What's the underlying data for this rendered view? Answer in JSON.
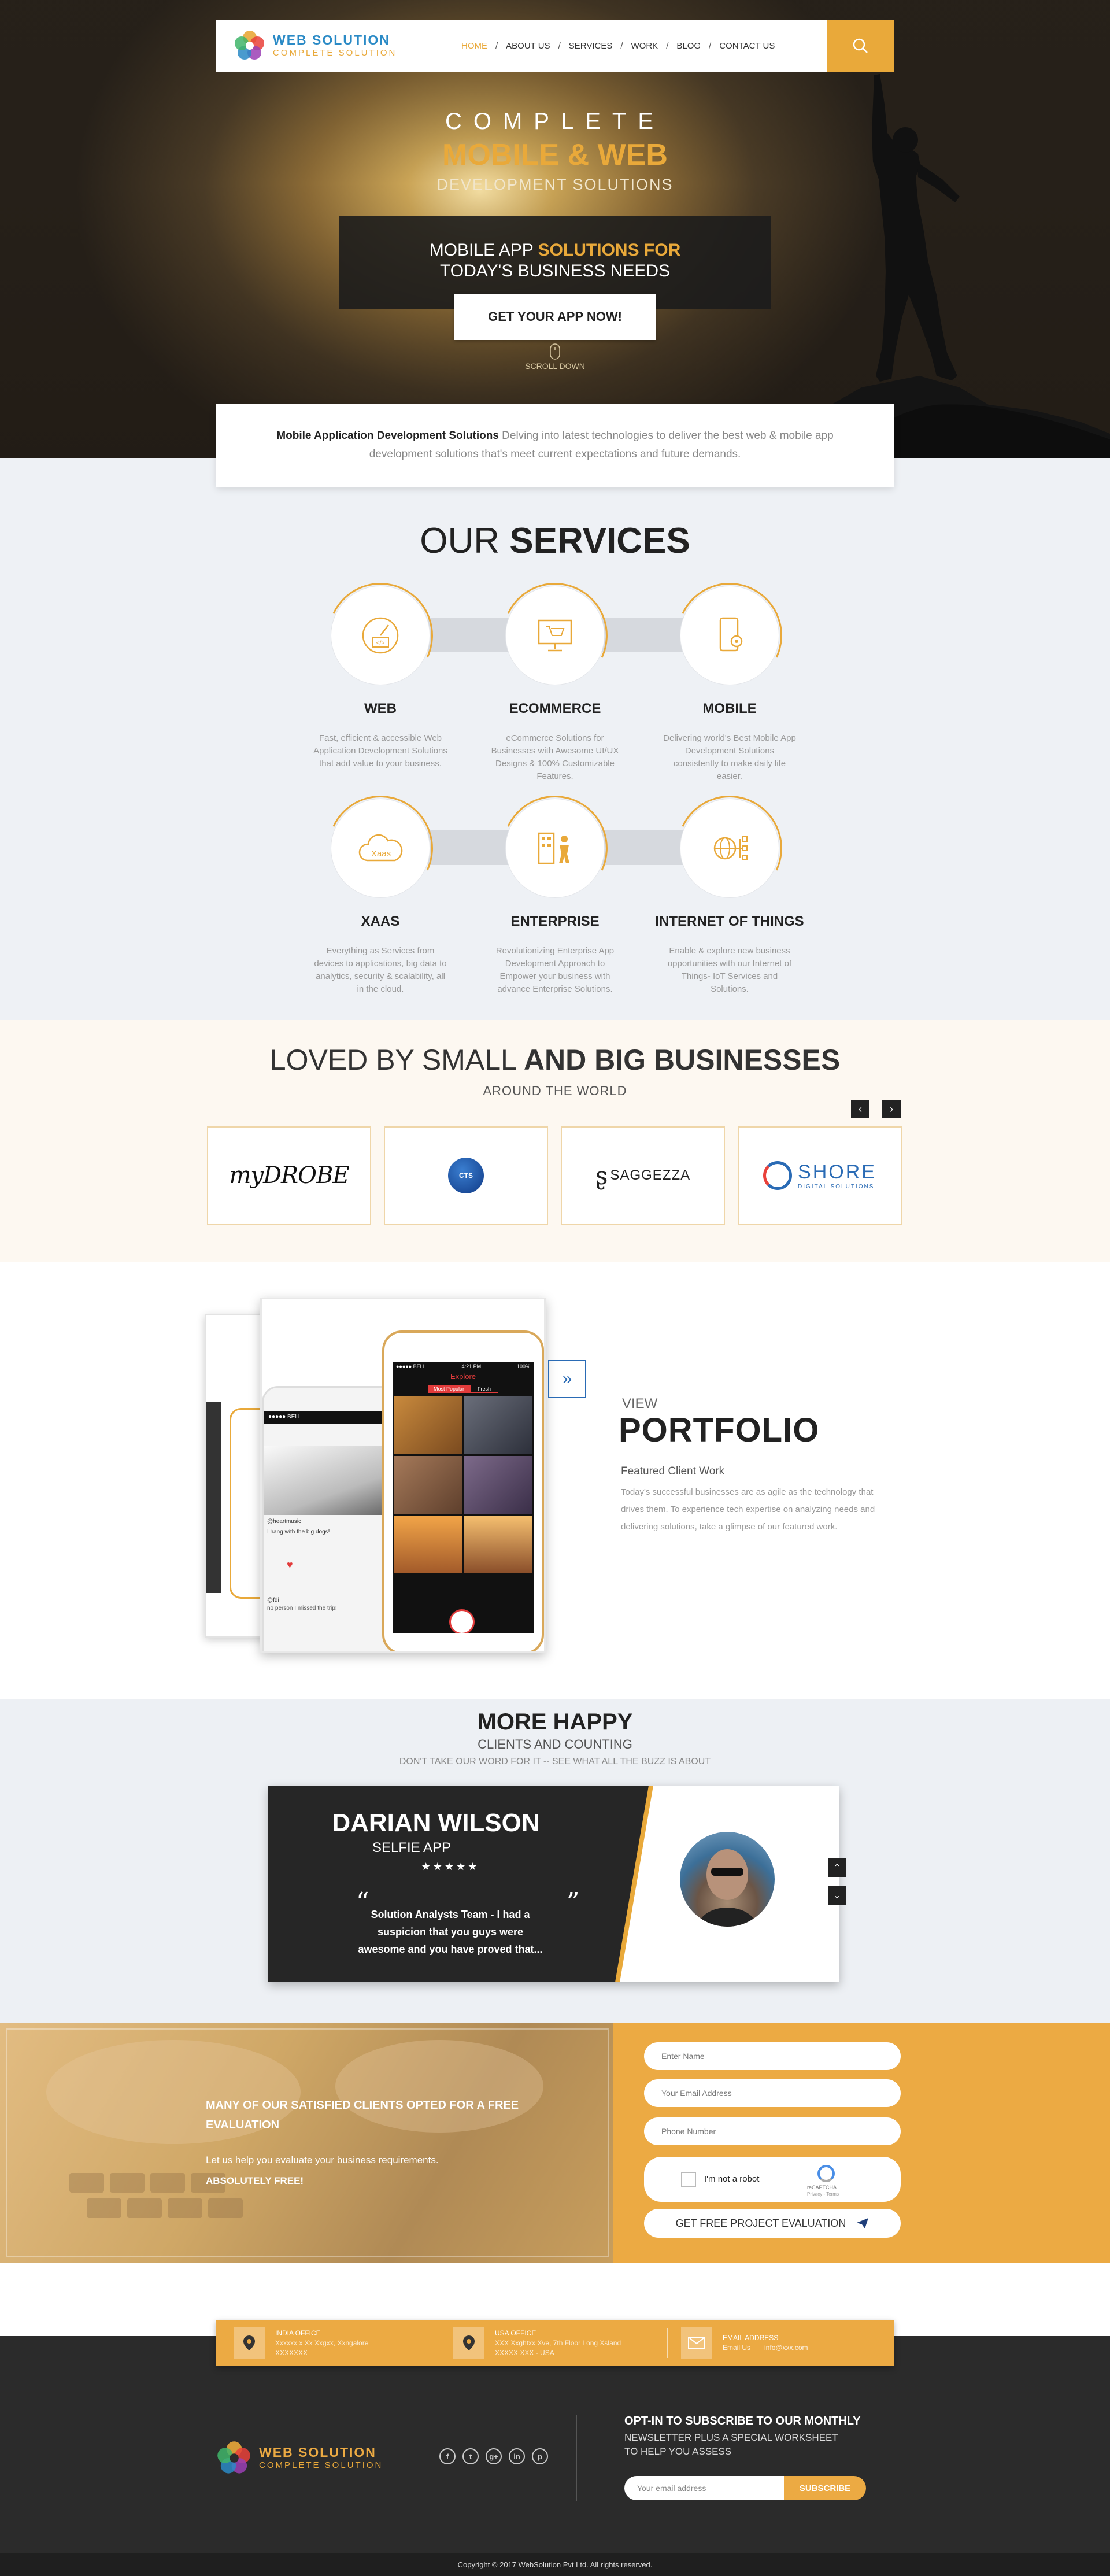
{
  "brand": {
    "name": "WEB SOLUTION",
    "tagline": "COMPLETE SOLUTION"
  },
  "nav": {
    "items": [
      {
        "label": "HOME",
        "active": true
      },
      {
        "label": "ABOUT US",
        "active": false
      },
      {
        "label": "SERVICES",
        "active": false
      },
      {
        "label": "WORK",
        "active": false
      },
      {
        "label": "BLOG",
        "active": false
      },
      {
        "label": "CONTACT US",
        "active": false
      }
    ],
    "search_icon": "search-icon"
  },
  "hero": {
    "line1": "COMPLETE",
    "line2": "MOBILE & WEB",
    "line3": "DEVELOPMENT SOLUTIONS",
    "box_line1_plain": "MOBILE APP ",
    "box_line1_accent": "SOLUTIONS FOR",
    "box_line2": "TODAY'S BUSINESS NEEDS",
    "cta": "GET YOUR APP NOW!",
    "scroll": "SCROLL DOWN"
  },
  "intro": {
    "bold": "Mobile Application Development Solutions",
    "text": " Delving into latest technologies to deliver the best web & mobile app development solutions that's meet current expectations and future demands."
  },
  "services": {
    "title_plain": "OUR ",
    "title_bold": "SERVICES",
    "items": [
      {
        "title": "WEB",
        "desc": "Fast, efficient & accessible Web Application Development Solutions that add value to your business.",
        "icon": "speedometer-code-icon"
      },
      {
        "title": "ECOMMERCE",
        "desc": "eCommerce Solutions for Businesses with Awesome UI/UX Designs & 100% Customizable Features.",
        "icon": "shopping-cart-monitor-icon"
      },
      {
        "title": "MOBILE",
        "desc": "Delivering world's Best Mobile App Development Solutions consistently to make daily life easier.",
        "icon": "mobile-gear-icon"
      },
      {
        "title": "XAAS",
        "desc": "Everything as Services from devices to applications, big data to analytics, security & scalability, all in the cloud.",
        "icon": "cloud-xaas-icon",
        "icon_text": "Xaas"
      },
      {
        "title": "ENTERPRISE",
        "desc": "Revolutionizing Enterprise App Development Approach to Empower your business with advance Enterprise Solutions.",
        "icon": "building-person-icon"
      },
      {
        "title": "INTERNET OF THINGS",
        "desc": "Enable & explore new business opportunities with our Internet of Things- IoT Services and Solutions.",
        "icon": "globe-network-icon"
      }
    ]
  },
  "clients": {
    "title_plain": "LOVED BY SMALL ",
    "title_bold": "AND BIG BUSINESSES",
    "subtitle": "AROUND THE WORLD",
    "prev": "‹",
    "next": "›",
    "logos": [
      {
        "name": "myDROBE"
      },
      {
        "name": "CTS"
      },
      {
        "name": "SAGGEZZA"
      },
      {
        "name": "SHORE",
        "sub": "DIGITAL SOLUTIONS"
      }
    ]
  },
  "portfolio": {
    "view": "VIEW",
    "title": "PORTFOLIO",
    "subtitle": "Featured Client Work",
    "desc": "Today's successful businesses are as agile as the technology that drives them. To experience tech expertise on analyzing needs and delivering solutions, take a glimpse of our featured work.",
    "next_icon": "double-chevron-right-icon",
    "phone": {
      "carrier": "●●●●● BELL",
      "time": "4:21 PM",
      "battery": "100%",
      "app_title": "Explore",
      "tabs": [
        "Most Popular",
        "Fresh"
      ],
      "back_caption": "I hang with the big dogs!",
      "back_user": "@heartmusic",
      "comment_user": "@fdi",
      "comment": "no person I missed the trip!"
    }
  },
  "testimonial": {
    "title": "MORE HAPPY",
    "subtitle": "CLIENTS AND COUNTING",
    "tagline": "DON'T TAKE OUR WORD FOR IT -- SEE WHAT ALL THE BUZZ IS ABOUT",
    "name": "DARIAN WILSON",
    "app": "SELFIE APP",
    "stars": "★★★★★",
    "quote": "Solution Analysts Team - I had a suspicion that you guys were awesome and you have proved that...",
    "up": "⌃",
    "down": "⌄"
  },
  "evaluation": {
    "title": "MANY OF OUR SATISFIED CLIENTS OPTED FOR A FREE EVALUATION",
    "desc": "Let us help you evaluate your business requirements.",
    "free": "ABSOLUTELY FREE!",
    "fields": {
      "name": "Enter Name",
      "email": "Your Email Address",
      "phone": "Phone Number"
    },
    "captcha_label": "I'm not a robot",
    "captcha_brand": "reCAPTCHA",
    "captcha_terms": "Privacy - Terms",
    "submit": "GET FREE PROJECT EVALUATION"
  },
  "offices": [
    {
      "label": "INDIA OFFICE",
      "line1": "Xxxxxx x Xx Xxgxx, Xxngalore",
      "line2": "XXXXXXX",
      "icon": "map-pin-icon"
    },
    {
      "label": "USA OFFICE",
      "line1": "XXX Xxghtxx Xve, 7th Floor Long Xsland",
      "line2": "XXXXX XXX - USA",
      "icon": "map-pin-icon"
    },
    {
      "label": "EMAIL ADDRESS",
      "line1": "Email Us",
      "line2": "info@xxx.com",
      "icon": "envelope-icon"
    }
  ],
  "footer": {
    "socials": [
      "f",
      "t",
      "g+",
      "in",
      "p"
    ],
    "newsletter_title": "OPT-IN TO SUBSCRIBE TO OUR MONTHLY",
    "newsletter_sub1": "NEWSLETTER PLUS A SPECIAL WORKSHEET",
    "newsletter_sub2": "TO HELP YOU ASSESS",
    "input_placeholder": "Your email address",
    "subscribe": "SUBSCRIBE",
    "copyright": "Copyright © 2017 WebSolution Pvt Ltd. All rights reserved."
  },
  "colors": {
    "accent": "#e9a93a",
    "dark": "#262626",
    "link_blue": "#2a6bb5"
  }
}
